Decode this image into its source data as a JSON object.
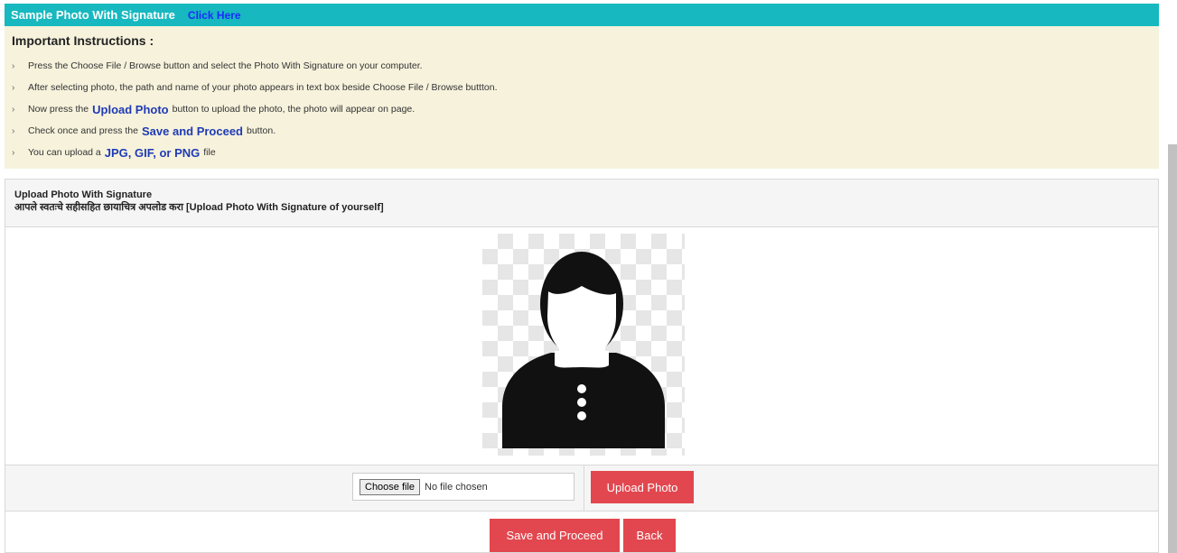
{
  "topbar": {
    "title": "Sample Photo With Signature",
    "link": "Click Here"
  },
  "instructions": {
    "heading": "Important Instructions :",
    "items": [
      {
        "before": "Press the Choose File / Browse button and select the Photo With Signature on your computer.",
        "highlight": "",
        "after": ""
      },
      {
        "before": "After selecting photo, the path and name of your photo appears in text box beside Choose File / Browse buttton.",
        "highlight": "",
        "after": ""
      },
      {
        "before": "Now press the",
        "highlight": "Upload Photo",
        "after": "button to upload the photo, the photo will appear on page."
      },
      {
        "before": "Check once and press the",
        "highlight": "Save and Proceed",
        "after": "button."
      },
      {
        "before": "You can upload a",
        "highlight": "JPG, GIF, or PNG",
        "after": "file"
      }
    ]
  },
  "panel": {
    "title": "Upload Photo With Signature",
    "subtitle": "आपले स्वतःचे सहीसहित छायाचित्र अपलोड करा [Upload Photo With Signature of yourself]"
  },
  "file_input": {
    "button": "Choose file",
    "status": "No file chosen"
  },
  "buttons": {
    "upload": "Upload Photo",
    "save": "Save and Proceed",
    "back": "Back"
  },
  "colors": {
    "topbar": "#17b8bf",
    "link": "#1a2cff",
    "instructions_bg": "#f6f2dc",
    "highlight": "#1f3bb5",
    "button": "#e2474f"
  },
  "icons": {
    "placeholder": "person-avatar-icon",
    "bullet": "chevron-right-icon"
  }
}
